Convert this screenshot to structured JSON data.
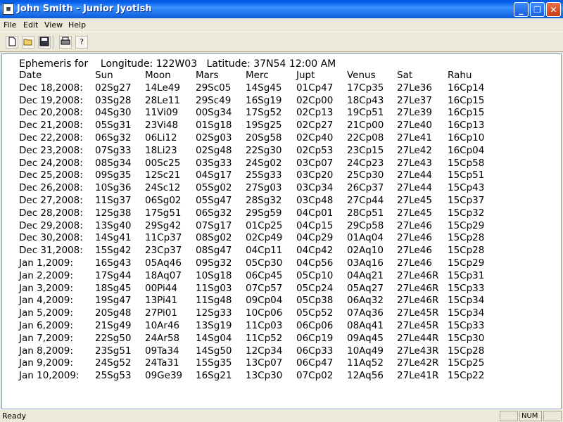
{
  "window": {
    "title": "John Smith - Junior Jyotish",
    "min": "_",
    "max": "❐",
    "close": "✕"
  },
  "menu": [
    "File",
    "Edit",
    "View",
    "Help"
  ],
  "toolbar": {
    "new": "",
    "open": "",
    "save": "",
    "print": "",
    "help": "?"
  },
  "header": {
    "ephemeris_label": "Ephemeris for",
    "longitude": "Longitude: 122W03",
    "latitude": "Latitude: 37N54",
    "time": "12:00 AM"
  },
  "columns": [
    "Date",
    "Sun",
    "Moon",
    "Mars",
    "Merc",
    "Jupt",
    "Venus",
    "Sat",
    "Rahu"
  ],
  "rows": [
    [
      "Dec 18,2008:",
      "02Sg27",
      "14Le49",
      "29Sc05",
      "14Sg45",
      "01Cp47",
      "17Cp35",
      "27Le36",
      "16Cp14"
    ],
    [
      "Dec 19,2008:",
      "03Sg28",
      "28Le11",
      "29Sc49",
      "16Sg19",
      "02Cp00",
      "18Cp43",
      "27Le37",
      "16Cp15"
    ],
    [
      "Dec 20,2008:",
      "04Sg30",
      "11Vi09",
      "00Sg34",
      "17Sg52",
      "02Cp13",
      "19Cp51",
      "27Le39",
      "16Cp15"
    ],
    [
      "Dec 21,2008:",
      "05Sg31",
      "23Vi48",
      "01Sg18",
      "19Sg25",
      "02Cp27",
      "21Cp00",
      "27Le40",
      "16Cp13"
    ],
    [
      "Dec 22,2008:",
      "06Sg32",
      "06Li12",
      "02Sg03",
      "20Sg58",
      "02Cp40",
      "22Cp08",
      "27Le41",
      "16Cp10"
    ],
    [
      "Dec 23,2008:",
      "07Sg33",
      "18Li23",
      "02Sg48",
      "22Sg30",
      "02Cp53",
      "23Cp15",
      "27Le42",
      "16Cp04"
    ],
    [
      "Dec 24,2008:",
      "08Sg34",
      "00Sc25",
      "03Sg33",
      "24Sg02",
      "03Cp07",
      "24Cp23",
      "27Le43",
      "15Cp58"
    ],
    [
      "Dec 25,2008:",
      "09Sg35",
      "12Sc21",
      "04Sg17",
      "25Sg33",
      "03Cp20",
      "25Cp30",
      "27Le44",
      "15Cp51"
    ],
    [
      "Dec 26,2008:",
      "10Sg36",
      "24Sc12",
      "05Sg02",
      "27Sg03",
      "03Cp34",
      "26Cp37",
      "27Le44",
      "15Cp43"
    ],
    [
      "Dec 27,2008:",
      "11Sg37",
      "06Sg02",
      "05Sg47",
      "28Sg32",
      "03Cp48",
      "27Cp44",
      "27Le45",
      "15Cp37"
    ],
    [
      "Dec 28,2008:",
      "12Sg38",
      "17Sg51",
      "06Sg32",
      "29Sg59",
      "04Cp01",
      "28Cp51",
      "27Le45",
      "15Cp32"
    ],
    [
      "Dec 29,2008:",
      "13Sg40",
      "29Sg42",
      "07Sg17",
      "01Cp25",
      "04Cp15",
      "29Cp58",
      "27Le46",
      "15Cp29"
    ],
    [
      "Dec 30,2008:",
      "14Sg41",
      "11Cp37",
      "08Sg02",
      "02Cp49",
      "04Cp29",
      "01Aq04",
      "27Le46",
      "15Cp28"
    ],
    [
      "Dec 31,2008:",
      "15Sg42",
      "23Cp37",
      "08Sg47",
      "04Cp11",
      "04Cp42",
      "02Aq10",
      "27Le46",
      "15Cp28"
    ],
    [
      "Jan  1,2009:",
      "16Sg43",
      "05Aq46",
      "09Sg32",
      "05Cp30",
      "04Cp56",
      "03Aq16",
      "27Le46",
      "15Cp29"
    ],
    [
      "Jan  2,2009:",
      "17Sg44",
      "18Aq07",
      "10Sg18",
      "06Cp45",
      "05Cp10",
      "04Aq21",
      "27Le46R",
      "15Cp31"
    ],
    [
      "Jan  3,2009:",
      "18Sg45",
      "00Pi44",
      "11Sg03",
      "07Cp57",
      "05Cp24",
      "05Aq27",
      "27Le46R",
      "15Cp33"
    ],
    [
      "Jan  4,2009:",
      "19Sg47",
      "13Pi41",
      "11Sg48",
      "09Cp04",
      "05Cp38",
      "06Aq32",
      "27Le46R",
      "15Cp34"
    ],
    [
      "Jan  5,2009:",
      "20Sg48",
      "27Pi01",
      "12Sg33",
      "10Cp06",
      "05Cp52",
      "07Aq36",
      "27Le45R",
      "15Cp34"
    ],
    [
      "Jan  6,2009:",
      "21Sg49",
      "10Ar46",
      "13Sg19",
      "11Cp03",
      "06Cp06",
      "08Aq41",
      "27Le45R",
      "15Cp33"
    ],
    [
      "Jan  7,2009:",
      "22Sg50",
      "24Ar58",
      "14Sg04",
      "11Cp52",
      "06Cp19",
      "09Aq45",
      "27Le44R",
      "15Cp30"
    ],
    [
      "Jan  8,2009:",
      "23Sg51",
      "09Ta34",
      "14Sg50",
      "12Cp34",
      "06Cp33",
      "10Aq49",
      "27Le43R",
      "15Cp28"
    ],
    [
      "Jan  9,2009:",
      "24Sg52",
      "24Ta31",
      "15Sg35",
      "13Cp07",
      "06Cp47",
      "11Aq52",
      "27Le42R",
      "15Cp25"
    ],
    [
      "Jan 10,2009:",
      "25Sg53",
      "09Ge39",
      "16Sg21",
      "13Cp30",
      "07Cp02",
      "12Aq56",
      "27Le41R",
      "15Cp22"
    ]
  ],
  "status": {
    "text": "Ready",
    "num": "NUM"
  }
}
